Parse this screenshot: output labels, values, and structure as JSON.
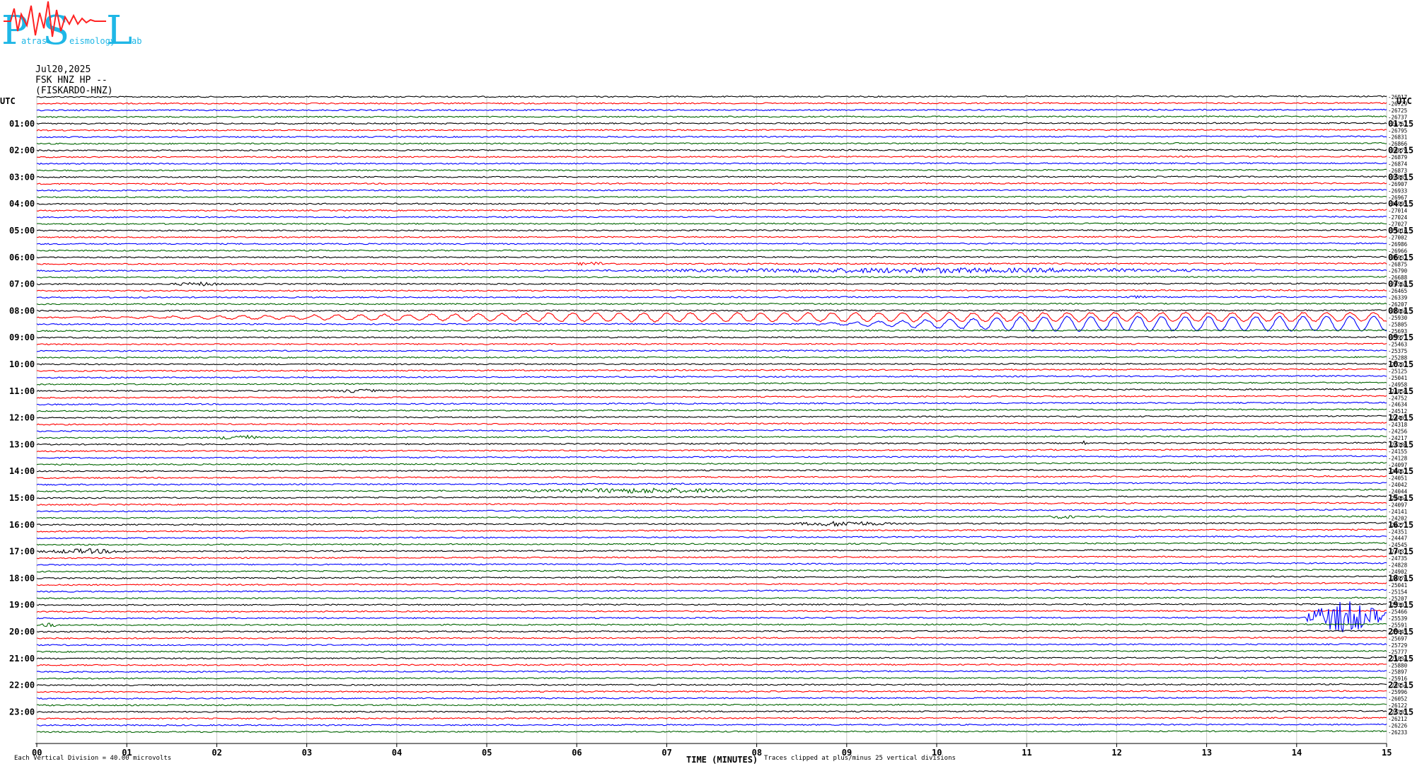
{
  "logo": {
    "letters": [
      "P",
      "S",
      "L"
    ],
    "words": [
      "atras",
      "eismology",
      "ab"
    ]
  },
  "header": {
    "date": "Jul20,2025",
    "channel": "FSK HNZ HP --",
    "station": "(FISKARDO-HNZ)"
  },
  "chart_data": {
    "type": "line",
    "description_type": "helicorder",
    "left_axis_title": "UTC",
    "right_axis_title": "UTC",
    "left_labels": [
      "01:00",
      "02:00",
      "03:00",
      "04:00",
      "05:00",
      "06:00",
      "07:00",
      "08:00",
      "09:00",
      "10:00",
      "11:00",
      "12:00",
      "13:00",
      "14:00",
      "15:00",
      "16:00",
      "17:00",
      "18:00",
      "19:00",
      "20:00",
      "21:00",
      "22:00",
      "23:00"
    ],
    "right_labels": [
      "01:15",
      "02:15",
      "03:15",
      "04:15",
      "05:15",
      "06:15",
      "07:15",
      "08:15",
      "09:15",
      "10:15",
      "11:15",
      "12:15",
      "13:15",
      "14:15",
      "15:15",
      "16:15",
      "17:15",
      "18:15",
      "19:15",
      "20:15",
      "21:15",
      "22:15",
      "23:15"
    ],
    "x_ticks": [
      "00",
      "01",
      "02",
      "03",
      "04",
      "05",
      "06",
      "07",
      "08",
      "09",
      "10",
      "11",
      "12",
      "13",
      "14",
      "15"
    ],
    "xlim": [
      0,
      15
    ],
    "xlabel": "TIME (MINUTES)",
    "trace_count": 96,
    "trace_colors": [
      "#000000",
      "#ff0000",
      "#0000ff",
      "#006400"
    ],
    "grid": true,
    "trace_values": [
      "-26917",
      "-26729",
      "-26725",
      "-26737",
      "-26767",
      "-26795",
      "-26831",
      "-26866",
      "-26879",
      "-26879",
      "-26874",
      "-26873",
      "-26885",
      "-26907",
      "-26933",
      "-26967",
      "-26995",
      "-27014",
      "-27024",
      "-27027",
      "-27016",
      "-27002",
      "-26986",
      "-26966",
      "-26932",
      "-26875",
      "-26790",
      "-26688",
      "-26568",
      "-26465",
      "-26339",
      "-26207",
      "-26066",
      "-25930",
      "-25805",
      "-25693",
      "-25571",
      "-25463",
      "-25375",
      "-25288",
      "-25207",
      "-25125",
      "-25041",
      "-24958",
      "-24856",
      "-24752",
      "-24634",
      "-24512",
      "-24405",
      "-24318",
      "-24256",
      "-24217",
      "-24186",
      "-24155",
      "-24128",
      "-24097",
      "-24067",
      "-24051",
      "-24042",
      "-24044",
      "-24064",
      "-24097",
      "-24141",
      "-24202",
      "-24271",
      "-24351",
      "-24447",
      "-24545",
      "-24637",
      "-24735",
      "-24828",
      "-24902",
      "-24976",
      "-25041",
      "-25154",
      "-25207",
      "-25303",
      "-25466",
      "-25539",
      "-25591",
      "-25645",
      "-25697",
      "-25729",
      "-25777",
      "-25834",
      "-25880",
      "-25897",
      "-25916",
      "-25954",
      "-25996",
      "-26052",
      "-26122",
      "-26185",
      "-26212",
      "-26226",
      "-26233"
    ],
    "events": [
      {
        "trace": 25,
        "start_min": 5.9,
        "end_min": 6.5,
        "amp": 3
      },
      {
        "trace": 26,
        "start_min": 6.1,
        "end_min": 13.8,
        "amp": 4
      },
      {
        "trace": 28,
        "start_min": 1.4,
        "end_min": 2.2,
        "amp": 3
      },
      {
        "trace": 30,
        "start_min": 11.9,
        "end_min": 12.5,
        "amp": 2
      },
      {
        "trace": 33,
        "start_min": 0.0,
        "end_min": 15.0,
        "amp": 6,
        "kind": "wave"
      },
      {
        "trace": 34,
        "start_min": 8.5,
        "end_min": 15.0,
        "amp": 10,
        "kind": "wave"
      },
      {
        "trace": 44,
        "start_min": 3.2,
        "end_min": 3.9,
        "amp": 3
      },
      {
        "trace": 51,
        "start_min": 2.0,
        "end_min": 2.5,
        "amp": 5
      },
      {
        "trace": 52,
        "start_min": 11.6,
        "end_min": 11.7,
        "amp": 4
      },
      {
        "trace": 59,
        "start_min": 5.2,
        "end_min": 8.3,
        "amp": 4
      },
      {
        "trace": 63,
        "start_min": 11.2,
        "end_min": 11.6,
        "amp": 3
      },
      {
        "trace": 64,
        "start_min": 8.3,
        "end_min": 9.6,
        "amp": 4
      },
      {
        "trace": 68,
        "start_min": 0.0,
        "end_min": 1.1,
        "amp": 4
      },
      {
        "trace": 78,
        "start_min": 14.1,
        "end_min": 15.0,
        "amp": 26
      },
      {
        "trace": 79,
        "start_min": 0.0,
        "end_min": 0.3,
        "amp": 3
      }
    ],
    "footer_left": "Each Vertical Division =   40.00 microvolts",
    "footer_right": "Traces clipped at plus/minus 25 vertical divisions"
  }
}
